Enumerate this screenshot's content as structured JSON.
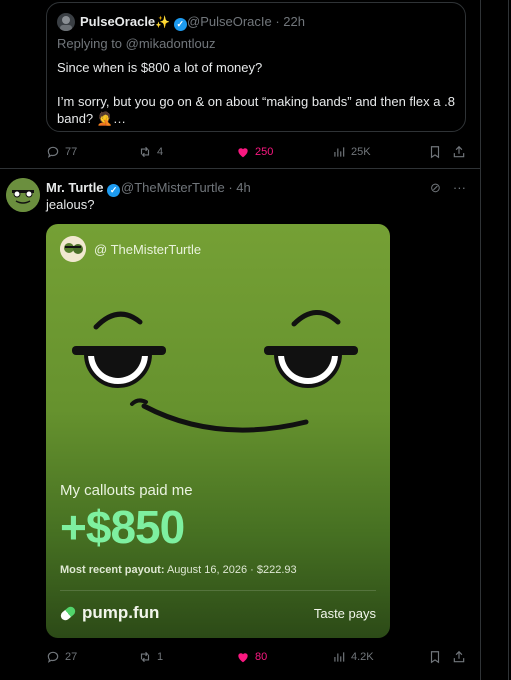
{
  "quoted": {
    "name": "PulseOracle",
    "name_suffix": "✨",
    "handle_time": "@PulseOracIe · 22h",
    "replying_to": "Replying to @mikadontlouz",
    "line1": "Since when is $800 a lot of money?",
    "line2": "I’m sorry, but you go on & on about “making bands” and then flex a .8",
    "line3": "band? 🤦…"
  },
  "actions_top": {
    "replies": "77",
    "reposts": "4",
    "likes": "250",
    "views": "25K"
  },
  "tweet": {
    "name": "Mr. Turtle",
    "handle_time": "@TheMisterTurtle · 4h",
    "text": "jealous?"
  },
  "card": {
    "handle": "@ TheMisterTurtle",
    "callouts": "My callouts paid me",
    "amount": "+$850",
    "payout_label": "Most recent payout:",
    "payout_date": "August 16, 2026",
    "payout_sep": "·",
    "payout_amount": "$222.93",
    "brand": "pump.fun",
    "tagline": "Taste pays"
  },
  "actions_bottom": {
    "replies": "27",
    "reposts": "1",
    "likes": "80",
    "views": "4.2K"
  },
  "colors": {
    "like_pink": "#f91880",
    "verified_blue": "#1d9bf0",
    "amount_green": "#7ef0a0"
  }
}
